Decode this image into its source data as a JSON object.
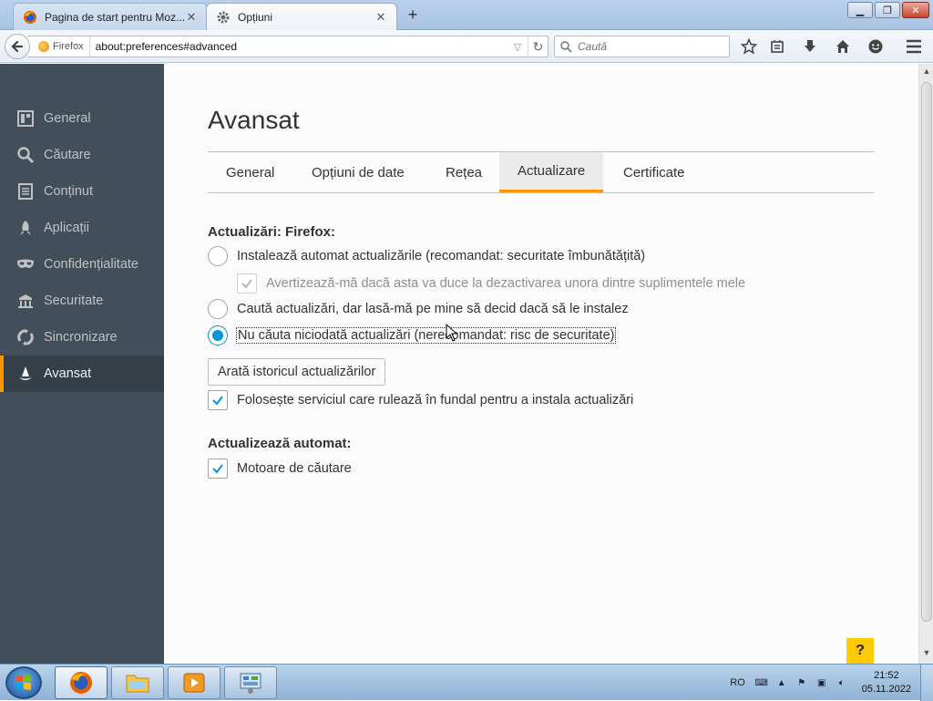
{
  "browser": {
    "tabs": [
      {
        "label": "Pagina de start pentru Moz...",
        "icon": "firefox-icon",
        "active": false
      },
      {
        "label": "Opțiuni",
        "icon": "gear-icon",
        "active": true
      }
    ],
    "new_tab": "+",
    "url_identity": "Firefox",
    "url": "about:preferences#advanced",
    "search_placeholder": "Caută"
  },
  "sidebar": {
    "items": [
      {
        "label": "General",
        "icon": "general-icon",
        "selected": false
      },
      {
        "label": "Căutare",
        "icon": "search-icon",
        "selected": false
      },
      {
        "label": "Conținut",
        "icon": "content-icon",
        "selected": false
      },
      {
        "label": "Aplicații",
        "icon": "applications-icon",
        "selected": false
      },
      {
        "label": "Confidențialitate",
        "icon": "privacy-mask-icon",
        "selected": false
      },
      {
        "label": "Securitate",
        "icon": "security-lock-icon",
        "selected": false
      },
      {
        "label": "Sincronizare",
        "icon": "sync-icon",
        "selected": false
      },
      {
        "label": "Avansat",
        "icon": "advanced-wizard-icon",
        "selected": true
      }
    ]
  },
  "main": {
    "title": "Avansat",
    "tabs": [
      {
        "label": "General",
        "selected": false
      },
      {
        "label": "Opțiuni de date",
        "selected": false
      },
      {
        "label": "Rețea",
        "selected": false
      },
      {
        "label": "Actualizare",
        "selected": true
      },
      {
        "label": "Certificate",
        "selected": false
      }
    ],
    "updates_group": {
      "title": "Actualizări: Firefox:",
      "auto_install": "Instalează automat actualizările (recomandat: securitate îmbunătățită)",
      "warn_addons": "Avertizează-mă dacă asta va duce la dezactivarea unora dintre suplimentele mele",
      "check_but_ask": "Caută actualizări, dar lasă-mă pe mine să decid dacă să le instalez",
      "never_check": "Nu căuta niciodată actualizări (nerecomandat: risc de securitate)",
      "selected_option": "never_check",
      "history_button": "Arată istoricul actualizărilor",
      "background_service": "Folosește serviciul care rulează în fundal pentru a instala actualizări",
      "background_service_checked": true
    },
    "auto_update_group": {
      "title": "Actualizează automat:",
      "search_engines": "Motoare de căutare",
      "search_engines_checked": true
    },
    "help": "?"
  },
  "taskbar": {
    "language": "RO",
    "time": "21:52",
    "date": "05.11.2022"
  },
  "colors": {
    "accent": "#ff9500",
    "radio_blue": "#0095dd",
    "sidebar_bg": "#424f5a",
    "help_yellow": "#ffcb00"
  }
}
